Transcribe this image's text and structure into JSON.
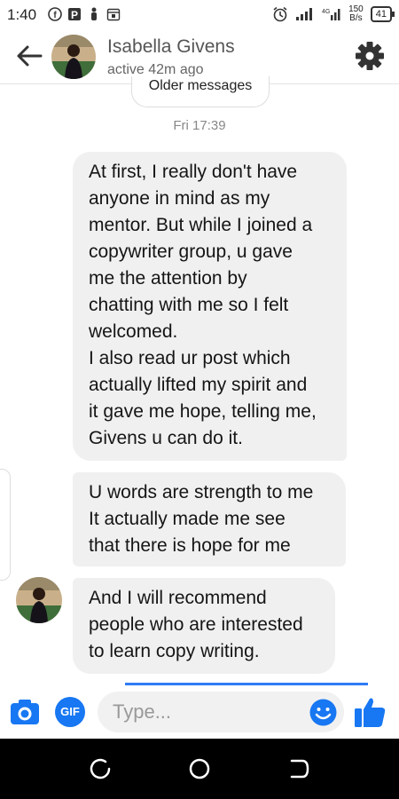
{
  "status_bar": {
    "time": "1:40",
    "net_speed_value": "150",
    "net_speed_unit": "B/s",
    "battery": "41",
    "network_type": "4G"
  },
  "header": {
    "contact_name": "Isabella Givens",
    "contact_status": "active 42m ago",
    "back_icon": "arrow-left-icon",
    "settings_icon": "gear-icon"
  },
  "chat": {
    "older_messages_label": "Older messages",
    "timestamp": "Fri 17:39",
    "messages": [
      {
        "text": "At first, I really don't have\nanyone in mind as my\nmentor. But while I joined a\ncopywriter group, u gave\nme the attention by\nchatting with me so I felt\nwelcomed.\nI also read ur post which\nactually lifted my spirit and\nit gave me hope, telling me,\nGivens u can do it."
      },
      {
        "text": "U words are strength to me\nIt actually made me see\nthat there is hope for me"
      },
      {
        "text": "And I will recommend\npeople who are interested\nto learn copy writing."
      }
    ]
  },
  "composer": {
    "placeholder": "Type...",
    "gif_label": "GIF"
  },
  "colors": {
    "accent": "#1877f2",
    "bubble": "#f1f0f0",
    "timestamp": "#888888"
  }
}
